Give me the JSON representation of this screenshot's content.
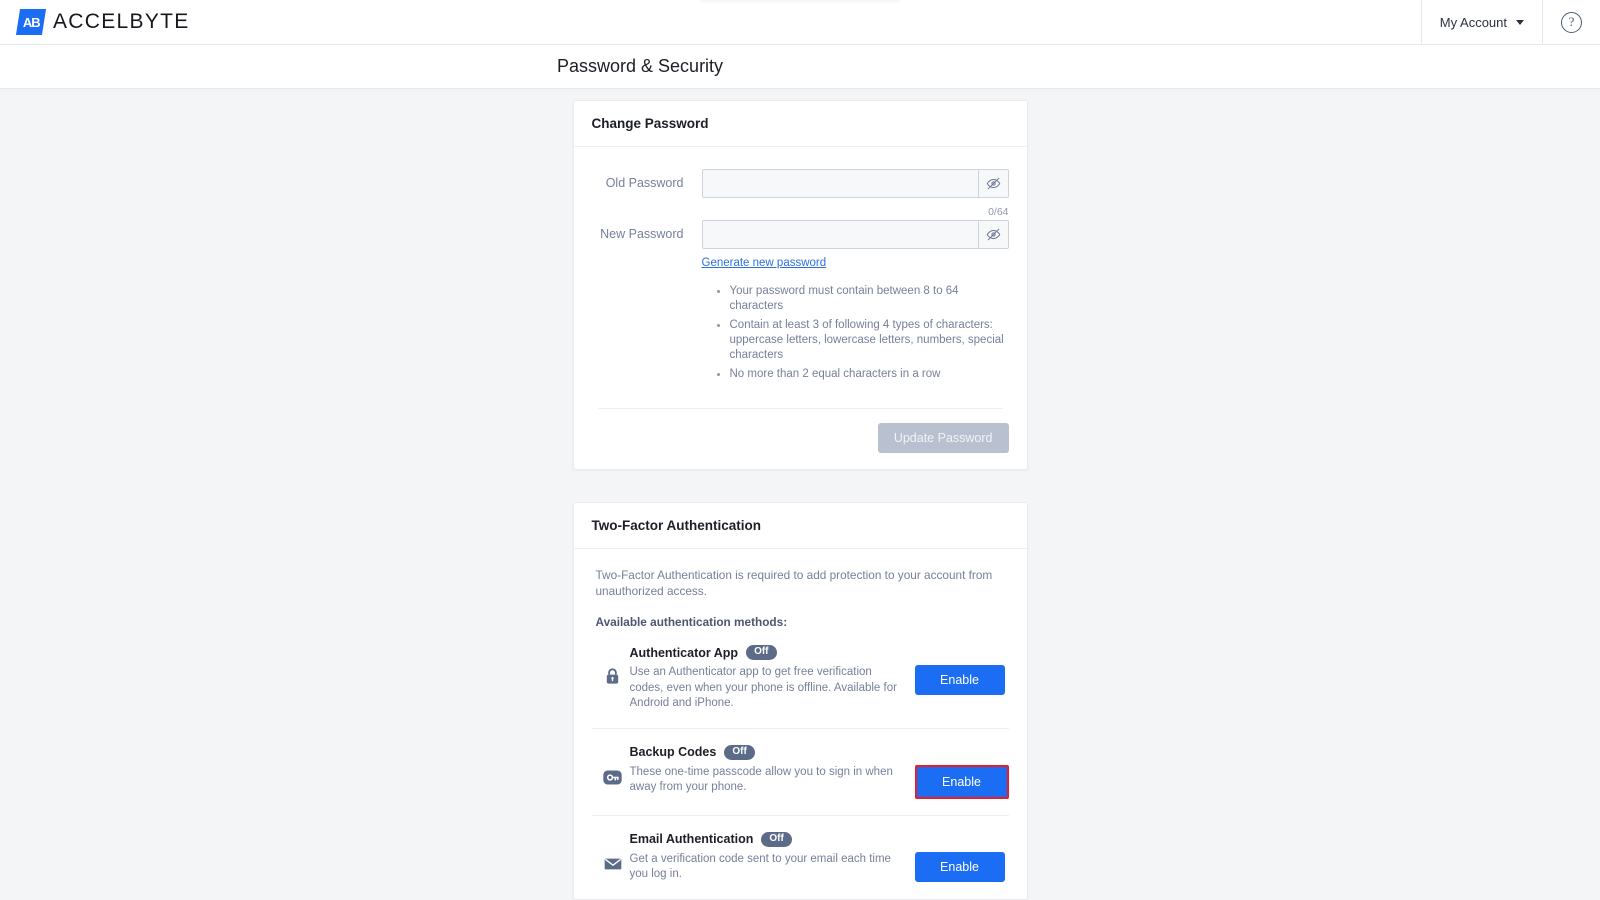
{
  "topbar": {
    "brand_mark": "AB",
    "brand_name": "ACCELBYTE",
    "account_label": "My Account",
    "help_label": "?"
  },
  "page": {
    "title": "Password & Security"
  },
  "change_password": {
    "heading": "Change Password",
    "old_password": {
      "label": "Old Password",
      "value": "",
      "placeholder": ""
    },
    "new_password": {
      "label": "New Password",
      "value": "",
      "placeholder": "",
      "counter": "0/64",
      "generate_link": "Generate new password"
    },
    "rules": [
      "Your password must contain between 8 to 64 characters",
      "Contain at least 3 of following 4 types of characters: uppercase letters, lowercase letters, numbers, special characters",
      "No more than 2 equal characters in a row"
    ],
    "update_button": "Update Password"
  },
  "two_factor": {
    "heading": "Two-Factor Authentication",
    "intro": "Two-Factor Authentication is required to add protection to your account from unauthorized access.",
    "subheading": "Available authentication methods:",
    "methods": [
      {
        "icon": "lock-icon",
        "title": "Authenticator App",
        "status": "Off",
        "description": "Use an Authenticator app to get free verification codes, even when your phone is offline. Available for Android and iPhone.",
        "action": "Enable",
        "highlighted": false
      },
      {
        "icon": "key-icon",
        "title": "Backup Codes",
        "status": "Off",
        "description": "These one-time passcode allow you to sign in when away from your phone.",
        "action": "Enable",
        "highlighted": true
      },
      {
        "icon": "envelope-icon",
        "title": "Email Authentication",
        "status": "Off",
        "description": "Get a verification code sent to your email each time you log in.",
        "action": "Enable",
        "highlighted": false
      }
    ]
  },
  "colors": {
    "brand_blue": "#1b6ef3",
    "link_blue": "#2e6fe0",
    "badge_slate": "#5c6b88",
    "highlight_red": "#ec1c24",
    "page_bg": "#f4f5f7"
  }
}
